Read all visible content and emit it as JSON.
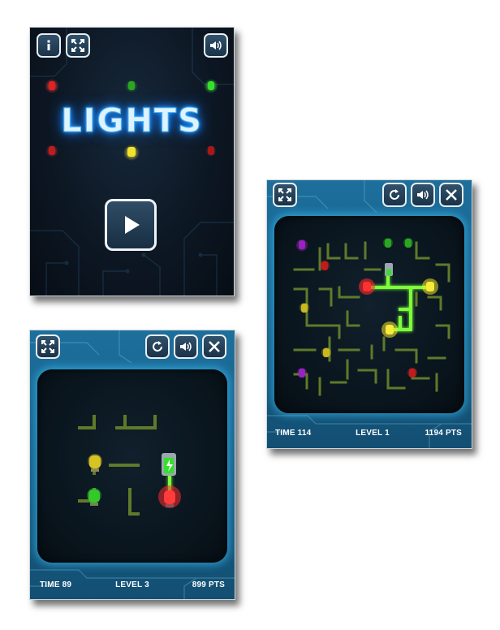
{
  "title_screen": {
    "logo_text": "LIGHTS",
    "buttons": {
      "info": "info-icon",
      "fullscreen": "fullscreen-icon",
      "sound": "speaker-icon",
      "play": "play-icon"
    },
    "bulb_colors": {
      "red": "#ff2a2a",
      "green": "#35e02a",
      "yellow": "#f2e32a"
    }
  },
  "level_1": {
    "time_label": "TIME 114",
    "level_label": "LEVEL 1",
    "points_label": "1194 PTS",
    "buttons": [
      "fullscreen-icon",
      "restart-icon",
      "speaker-icon",
      "close-icon"
    ]
  },
  "level_3": {
    "time_label": "TIME 89",
    "level_label": "LEVEL 3",
    "points_label": "899 PTS",
    "buttons": [
      "fullscreen-icon",
      "restart-icon",
      "speaker-icon",
      "close-icon"
    ]
  },
  "colors": {
    "pipe_off": "#5f7a2a",
    "pipe_on": "#7dff3a",
    "frame": "#1b6a95",
    "board_glow": "#3cc8ff"
  }
}
